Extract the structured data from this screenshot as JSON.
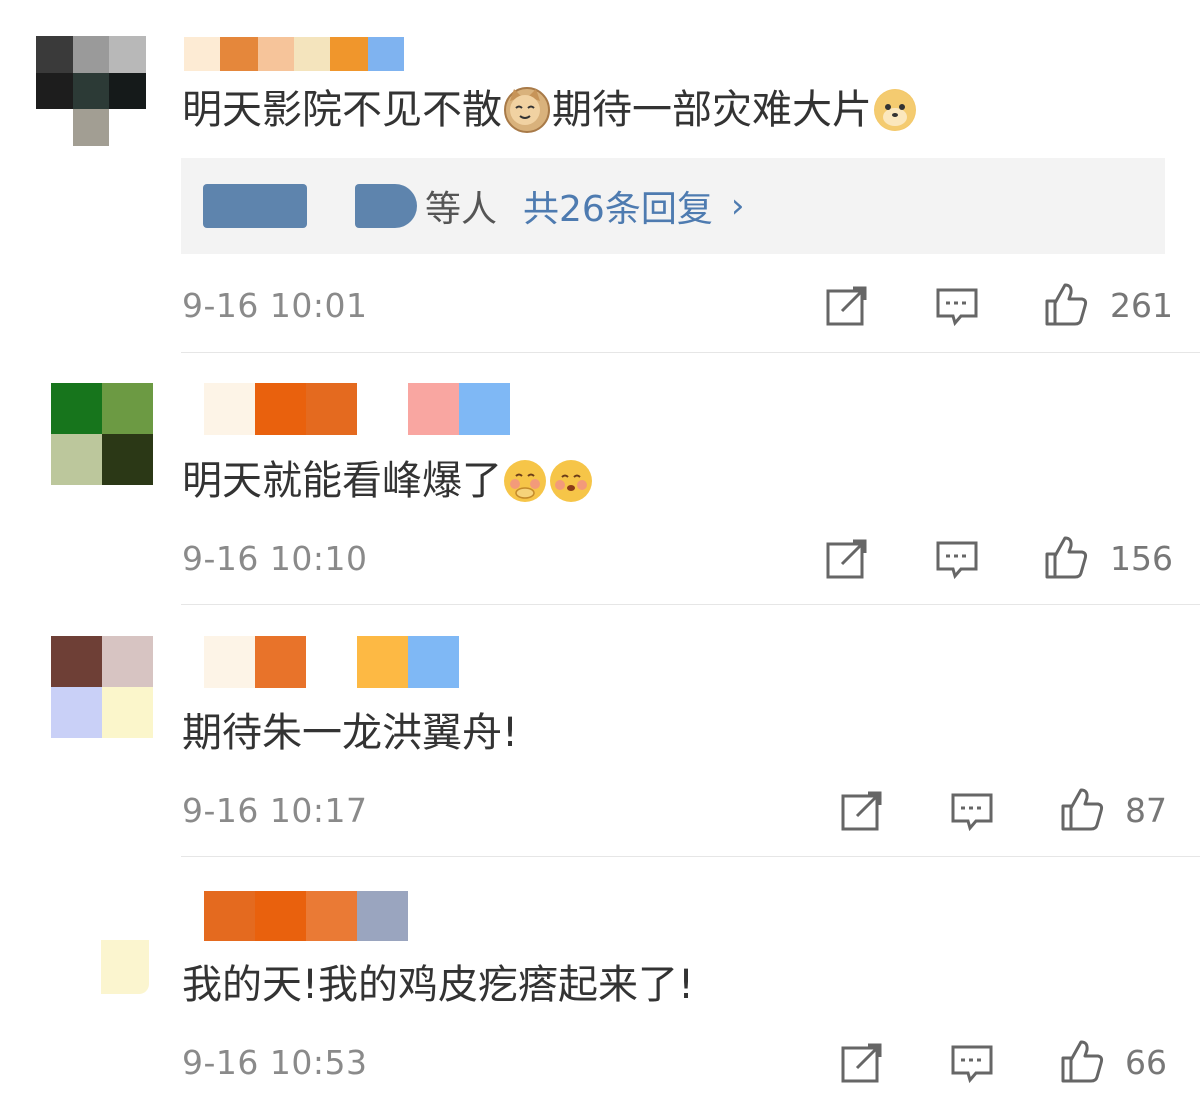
{
  "comments": [
    {
      "text_before": "明天影院不见不散",
      "emoji_1": "cat-emoji",
      "text_after": "期待一部灾难大片",
      "emoji_2": "doge-emoji",
      "reply_summary": {
        "suffix": "等人",
        "link": "共26条回复",
        "chevron": "›"
      },
      "time": "9-16 10:01",
      "likes": "261",
      "colors": {
        "name": [
          "#fde3c4",
          "#e5873b",
          "#f7c8a0",
          "#f4e1b7",
          "#f0962c",
          "#7fb3f0"
        ]
      }
    },
    {
      "text": "明天就能看峰爆了",
      "emoji_1": "shy-emoji",
      "emoji_2": "blush-emoji",
      "time": "9-16 10:10",
      "likes": "156"
    },
    {
      "text": "期待朱一龙洪翼舟!",
      "time": "9-16 10:17",
      "likes": "87"
    },
    {
      "text": "我的天!我的鸡皮疙瘩起来了!",
      "time": "9-16 10:53",
      "likes": "66"
    }
  ],
  "icons": {
    "share": "share-icon",
    "comment": "comment-icon",
    "like": "thumbs-up-icon"
  }
}
